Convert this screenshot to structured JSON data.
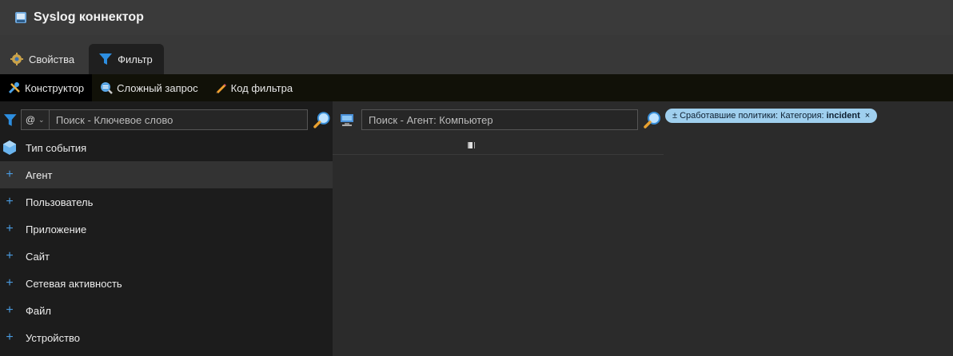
{
  "window": {
    "title": "Syslog коннектор",
    "icon": "log-app-icon"
  },
  "tabs": [
    {
      "label": "Свойства",
      "icon": "gear-icon",
      "active": false
    },
    {
      "label": "Фильтр",
      "icon": "funnel-icon",
      "active": true
    }
  ],
  "toolbar": [
    {
      "label": "Конструктор",
      "icon": "wrench-tools-icon",
      "active": true
    },
    {
      "label": "Сложный запрос",
      "icon": "query-search-icon",
      "active": false
    },
    {
      "label": "Код фильтра",
      "icon": "pencil-icon",
      "active": false
    }
  ],
  "left_search": {
    "selector_value": "@",
    "placeholder": "Поиск - Ключевое слово",
    "icon": "magnifier-icon"
  },
  "tree": [
    {
      "label": "Тип события",
      "icon": "hexagon-icon",
      "selected": false
    },
    {
      "label": "Агент",
      "icon": "plus-icon",
      "selected": true
    },
    {
      "label": "Пользователь",
      "icon": "plus-icon",
      "selected": false
    },
    {
      "label": "Приложение",
      "icon": "plus-icon",
      "selected": false
    },
    {
      "label": "Сайт",
      "icon": "plus-icon",
      "selected": false
    },
    {
      "label": "Сетевая активность",
      "icon": "plus-icon",
      "selected": false
    },
    {
      "label": "Файл",
      "icon": "plus-icon",
      "selected": false
    },
    {
      "label": "Устройство",
      "icon": "plus-icon",
      "selected": false
    }
  ],
  "mid_search": {
    "placeholder": "Поиск - Агент: Компьютер",
    "icon": "computer-icon"
  },
  "active_filter": {
    "prefix": "± Сработавшие политики: Категория:",
    "value": "incident",
    "close": "×"
  },
  "colors": {
    "accent": "#4a9be0",
    "chip_bg": "#9fcfee",
    "toolbar_bg": "#111108"
  }
}
